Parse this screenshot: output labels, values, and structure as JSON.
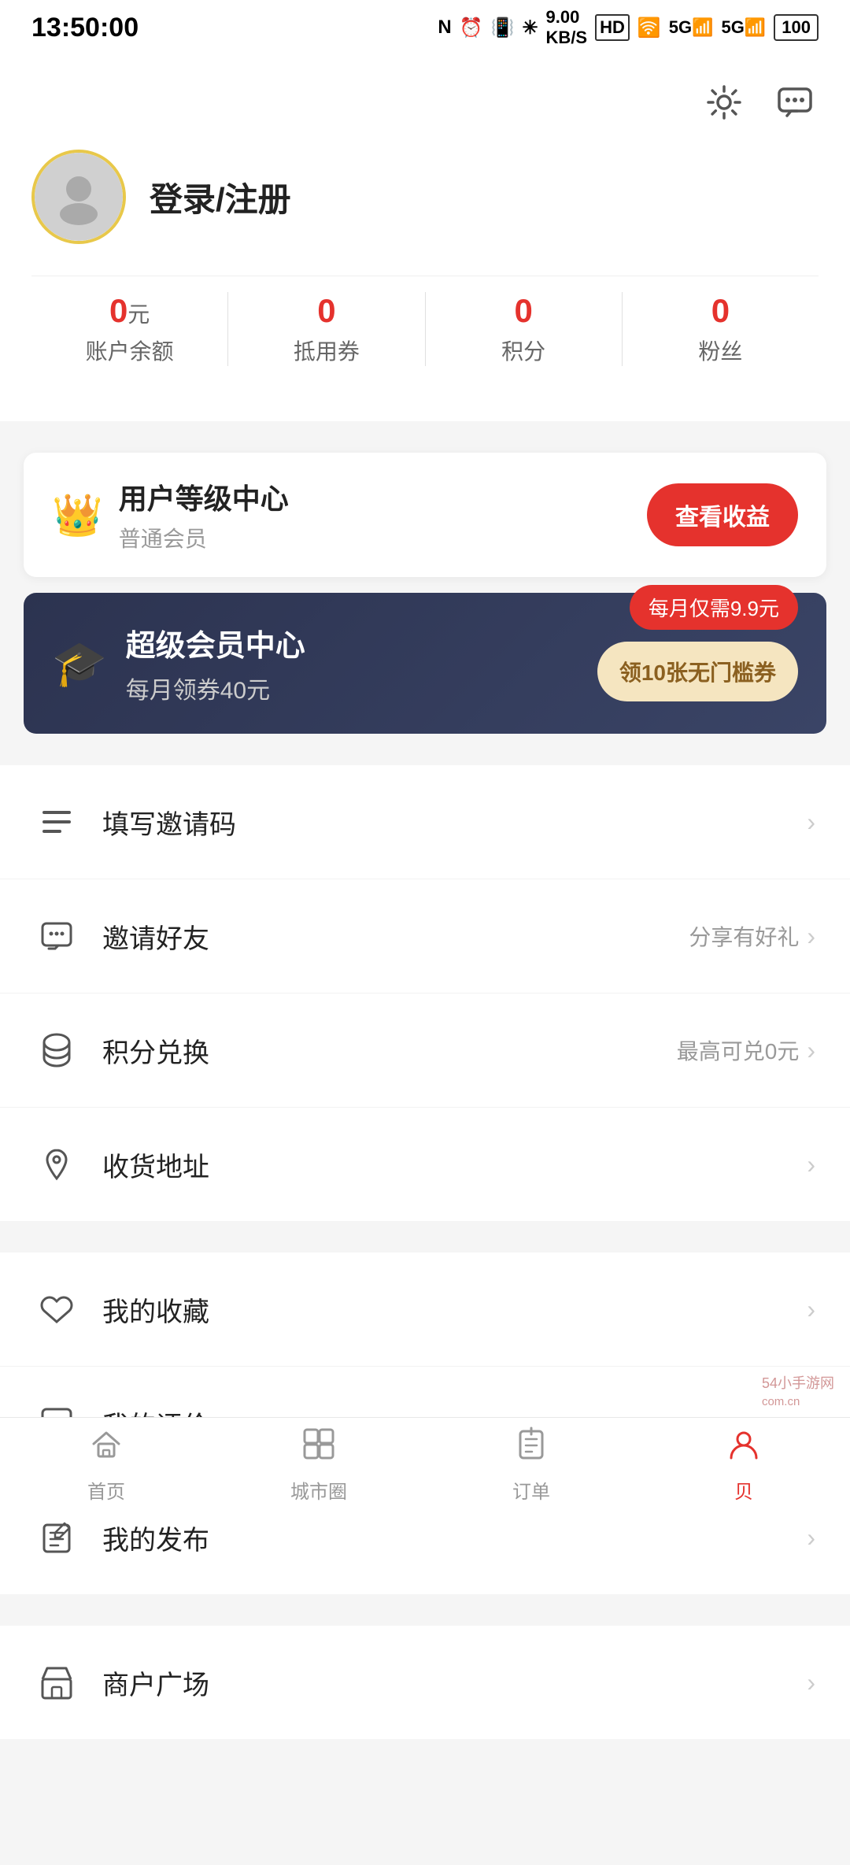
{
  "statusBar": {
    "time": "13:50:00",
    "icons": "NFC ⏰ 📳 ✳ 9.00KB/S HD 🛜 5G 5G 100"
  },
  "header": {
    "settingsIcon": "⚙",
    "messageIcon": "💬"
  },
  "userProfile": {
    "loginText": "登录/注册"
  },
  "stats": [
    {
      "value": "0",
      "unit": "元",
      "label": "账户余额"
    },
    {
      "value": "0",
      "unit": "",
      "label": "抵用券"
    },
    {
      "value": "0",
      "unit": "",
      "label": "积分"
    },
    {
      "value": "0",
      "unit": "",
      "label": "粉丝"
    }
  ],
  "levelCard": {
    "icon": "👑",
    "title": "用户等级中心",
    "subtitle": "普通会员",
    "buttonLabel": "查看收益"
  },
  "superMember": {
    "icon": "🎓",
    "title": "超级会员中心",
    "subtitle": "每月领券40元",
    "priceBadge": "每月仅需9.9元",
    "couponButton": "领10张无门槛券"
  },
  "menuGroups": [
    {
      "items": [
        {
          "icon": "≡",
          "label": "填写邀请码",
          "right": "",
          "iconType": "list"
        },
        {
          "icon": "✉",
          "label": "邀请好友",
          "right": "分享有好礼",
          "iconType": "envelope"
        },
        {
          "icon": "🗃",
          "label": "积分兑换",
          "right": "最高可兑0元",
          "iconType": "coin"
        },
        {
          "icon": "📍",
          "label": "收货地址",
          "right": "",
          "iconType": "location"
        }
      ]
    },
    {
      "items": [
        {
          "icon": "☆",
          "label": "我的收藏",
          "right": "",
          "iconType": "star"
        },
        {
          "icon": "💬",
          "label": "我的评价",
          "right": "",
          "iconType": "comment"
        },
        {
          "icon": "✏",
          "label": "我的发布",
          "right": "",
          "iconType": "edit"
        }
      ]
    },
    {
      "items": [
        {
          "icon": "🏪",
          "label": "商户广场",
          "right": "",
          "iconType": "store"
        }
      ]
    }
  ],
  "bottomNav": [
    {
      "icon": "🏠",
      "label": "首页",
      "active": false
    },
    {
      "icon": "⊞",
      "label": "城市圈",
      "active": false
    },
    {
      "icon": "📋",
      "label": "订单",
      "active": false
    },
    {
      "icon": "👤",
      "label": "贝",
      "active": true
    }
  ],
  "watermark": "54小手游网"
}
